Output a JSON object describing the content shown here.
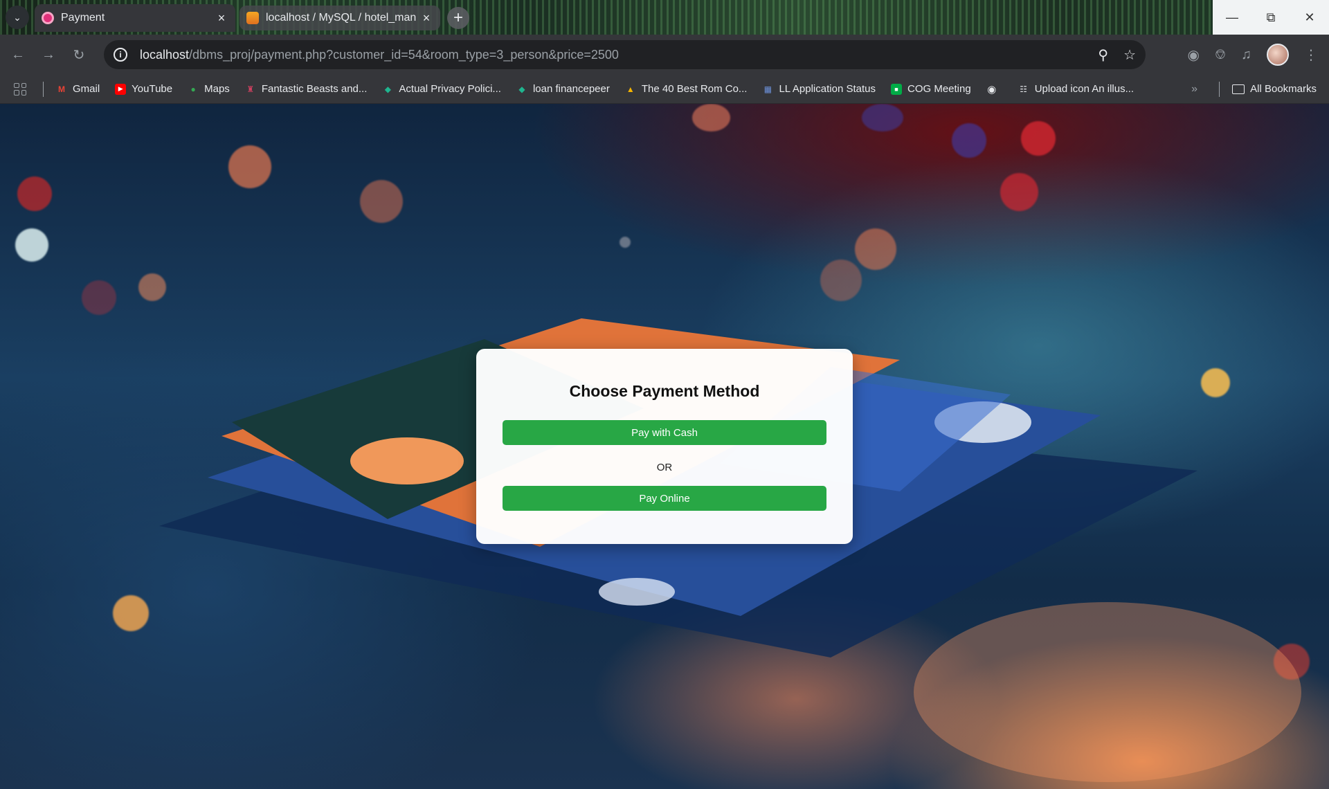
{
  "browser": {
    "tabs": [
      {
        "title": "Payment",
        "active": true
      },
      {
        "title": "localhost / MySQL / hotel_man",
        "active": false
      }
    ],
    "url": {
      "host": "localhost",
      "path": "/dbms_proj/payment.php?customer_id=54&room_type=3_person&price=2500"
    },
    "bookmarks": [
      {
        "label": "Gmail",
        "icon": "gmail-icon",
        "color": "#ea4335"
      },
      {
        "label": "YouTube",
        "icon": "youtube-icon",
        "color": "#ff0000"
      },
      {
        "label": "Maps",
        "icon": "maps-icon",
        "color": "#34a853"
      },
      {
        "label": "Fantastic Beasts and...",
        "icon": "castle-icon",
        "color": "#d04060"
      },
      {
        "label": "Actual Privacy Polici...",
        "icon": "drop-icon",
        "color": "#1fb58f"
      },
      {
        "label": "loan financepeer",
        "icon": "drop-icon",
        "color": "#1fb58f"
      },
      {
        "label": "The 40 Best Rom Co...",
        "icon": "triangle-icon",
        "color": "#f4b400"
      },
      {
        "label": "LL Application Status",
        "icon": "building-icon",
        "color": "#6b8fd6"
      },
      {
        "label": "COG Meeting",
        "icon": "meet-icon",
        "color": "#00ac47"
      },
      {
        "label": "",
        "icon": "globe-icon",
        "color": "#e8eaed"
      },
      {
        "label": "Upload icon An illus...",
        "icon": "bank-icon",
        "color": "#e8eaed"
      }
    ],
    "all_bookmarks_label": "All Bookmarks"
  },
  "payment": {
    "title": "Choose Payment Method",
    "cash_button": "Pay with Cash",
    "separator": "OR",
    "online_button": "Pay Online",
    "button_color": "#28a745"
  }
}
